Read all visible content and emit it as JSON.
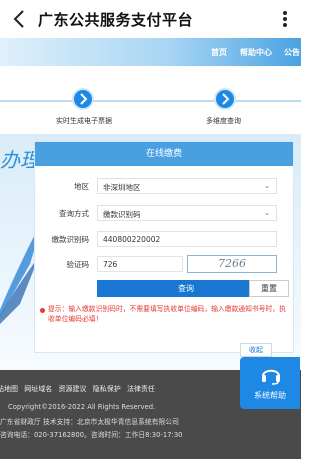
{
  "appbar": {
    "title": "广东公共服务支付平台"
  },
  "site_nav": {
    "items": [
      "首页",
      "帮助中心",
      "公告"
    ]
  },
  "steps": {
    "items": [
      "实时生成电子票据",
      "多维度查询"
    ]
  },
  "hero": {
    "slogan": "办理"
  },
  "form": {
    "title": "在线缴费",
    "region": {
      "label": "地区",
      "value": "非深圳地区"
    },
    "query_method": {
      "label": "查询方式",
      "value": "缴款识别码"
    },
    "payment_code": {
      "label": "缴款识别码",
      "value": "440800220002"
    },
    "captcha": {
      "label": "验证码",
      "value": "726",
      "image_text": "7266"
    },
    "query_button": "查询",
    "reset_button": "重置",
    "tip": "提示：输入缴款识别码时，不需要填写执收单位编码，输入缴款通知书号时，执收单位编码必填！"
  },
  "collapse_label": "收起",
  "footer": {
    "links": [
      "网站地图",
      "网址域名",
      "资源建议",
      "隐私保护",
      "法律责任"
    ],
    "copyright": "Copyright©2016-2022 All Rights Reserved.",
    "org": "广东省财政厅 技术支持：北京市太极华青信息系统有限公司",
    "phone": "咨询电话：020-37162800。咨询时间：工作日8:30-17:30"
  },
  "help": {
    "label": "系统帮助"
  },
  "colors": {
    "accent": "#1e88e5",
    "button": "#1976d2",
    "warning": "#e53935",
    "footer": "#4a4a4a"
  }
}
